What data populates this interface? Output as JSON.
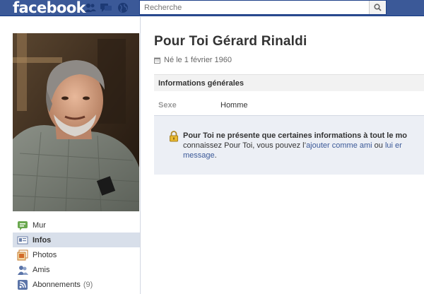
{
  "topbar": {
    "logo": "facebook",
    "search_placeholder": "Recherche"
  },
  "profile": {
    "name": "Pour Toi Gérard Rinaldi",
    "birth": "Né le 1 février 1960"
  },
  "nav": {
    "items": [
      {
        "label": "Mur",
        "icon": "wall-icon"
      },
      {
        "label": "Infos",
        "icon": "info-icon",
        "active": true
      },
      {
        "label": "Photos",
        "icon": "photos-icon"
      },
      {
        "label": "Amis",
        "icon": "friends-icon"
      },
      {
        "label": "Abonnements",
        "icon": "subscriptions-icon",
        "count": "(9)"
      }
    ]
  },
  "info": {
    "section_title": "Informations générales",
    "rows": [
      {
        "key": "Sexe",
        "value": "Homme"
      }
    ]
  },
  "notice": {
    "line1_bold": "Pour Toi ne présente que certaines informations à tout le mo",
    "line2_prefix": "connaissez Pour Toi, vous pouvez l’",
    "add_friend_link": "ajouter comme ami",
    "line2_mid": " ou ",
    "message_link_part1": "lui er",
    "message_link_part2": "message",
    "line3_suffix": "."
  },
  "colors": {
    "brand": "#3b5998",
    "nav_active_bg": "#d8dfea",
    "notice_bg": "#eceff5"
  }
}
